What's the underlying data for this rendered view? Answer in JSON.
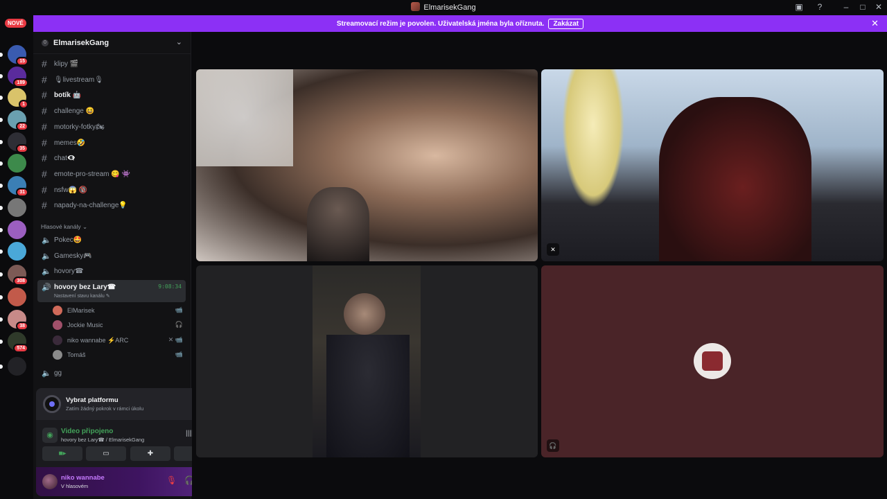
{
  "window": {
    "title": "ElmarisekGang"
  },
  "banner": {
    "message": "Streamovací režim je povolen. Uživatelská jména byla oříznuta.",
    "disable_label": "Zakázat"
  },
  "servers": {
    "new_badge": "NOVÉ",
    "items": [
      {
        "color": "#3a5bb0",
        "badge": "15"
      },
      {
        "color": "#5a2b9c",
        "badge": "189"
      },
      {
        "color": "#d9c36a",
        "badge": "1"
      },
      {
        "color": "#6aa0b0",
        "badge": "22"
      },
      {
        "color": "#2e2e35",
        "badge": "35"
      },
      {
        "color": "#3d8a4b",
        "badge": ""
      },
      {
        "color": "#3b7fb5",
        "badge": "31"
      },
      {
        "color": "#777777",
        "badge": ""
      },
      {
        "color": "#9b5fc0",
        "badge": ""
      },
      {
        "color": "#4aa8d8",
        "badge": ""
      },
      {
        "color": "#7c5a55",
        "badge": "308"
      },
      {
        "color": "#c25a4a",
        "badge": ""
      },
      {
        "color": "#c78a88",
        "badge": "38"
      },
      {
        "color": "#2f3a2a",
        "badge": "574"
      },
      {
        "color": "#222226",
        "badge": ""
      }
    ]
  },
  "guild": {
    "name": "ElmarisekGang"
  },
  "text_channels": [
    {
      "name": "klipy 🎬",
      "bold": false
    },
    {
      "name": "🎙livestream🎙",
      "bold": false
    },
    {
      "name": "botík 🤖",
      "bold": true
    },
    {
      "name": "challenge 😆",
      "bold": false
    },
    {
      "name": "motorky-fotky🏍",
      "bold": false
    },
    {
      "name": "memes🤣",
      "bold": false
    },
    {
      "name": "chat👁‍🗨",
      "bold": false
    },
    {
      "name": "emote-pro-stream 😋 👾",
      "bold": false
    },
    {
      "name": "nsfw😱 🔞",
      "bold": false
    },
    {
      "name": "napady-na-challenge💡",
      "bold": false
    }
  ],
  "voice_section": {
    "title": "Hlasové kanály"
  },
  "voice_channels_top": [
    "Pokec🤩",
    "Gamesky🎮",
    "hovory☎"
  ],
  "active_voice": {
    "name": "hovory bez Lary☎",
    "timer": "9:08:34",
    "status": "Nastavení stavu kanálu"
  },
  "voice_users": [
    {
      "name": "ElMarisek",
      "color": "#d06a5a",
      "icons": "📹"
    },
    {
      "name": "Jockie Music",
      "color": "#a0506a",
      "icons": "🎧"
    },
    {
      "name": "niko wannabe ⚡ARC",
      "color": "#3a2a3a",
      "icons": "✕ 📹"
    },
    {
      "name": "Tomáš",
      "color": "#8a8a8a",
      "icons": "📹"
    }
  ],
  "voice_channel_extra": "gg",
  "quest": {
    "title": "Vybrat platformu",
    "subtitle": "Zatím žádný pokrok v rámci úkolu"
  },
  "connection": {
    "title": "Video připojeno",
    "subtitle": "hovory bez Lary☎ / ElmarisekGang"
  },
  "user": {
    "name": "niko wannabe",
    "status": "V hlasovém"
  }
}
